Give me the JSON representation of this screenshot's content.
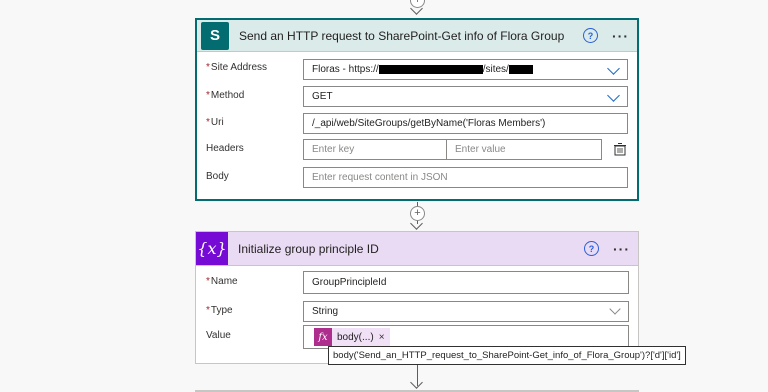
{
  "sharepoint_action": {
    "title": "Send an HTTP request to SharePoint-Get info of Flora Group",
    "icon": "sharepoint-icon",
    "icon_letter": "S",
    "fields": {
      "site_address": {
        "label": "Site Address",
        "value_prefix": "Floras - https://",
        "value_mid": "/sites/"
      },
      "method": {
        "label": "Method",
        "value": "GET"
      },
      "uri": {
        "label": "Uri",
        "value": "/_api/web/SiteGroups/getByName('Floras Members')"
      },
      "headers": {
        "label": "Headers",
        "key_placeholder": "Enter key",
        "value_placeholder": "Enter value"
      },
      "body": {
        "label": "Body",
        "placeholder": "Enter request content in JSON"
      }
    }
  },
  "variable_action": {
    "title": "Initialize group principle ID",
    "icon": "variable-icon",
    "icon_glyph": "{x}",
    "fields": {
      "name": {
        "label": "Name",
        "value": "GroupPrincipleId"
      },
      "type": {
        "label": "Type",
        "value": "String"
      },
      "value": {
        "label": "Value",
        "token_label": "body(...)",
        "token_icon": "fx",
        "token_remove": "×"
      }
    }
  },
  "tooltip": {
    "text": "body('Send_an_HTTP_request_to_SharePoint-Get_info_of_Flora_Group')?['d']['id']"
  },
  "common": {
    "help_glyph": "?",
    "more_glyph": "···",
    "required_mark": "*",
    "plus_glyph": "+"
  },
  "colors": {
    "sharepoint": "#036c70",
    "sharepoint_header": "#dbebea",
    "variable": "#770bd6",
    "variable_header": "#e8dbf3",
    "expression_token": "#ad2e8c",
    "link_blue": "#1e69c7"
  }
}
